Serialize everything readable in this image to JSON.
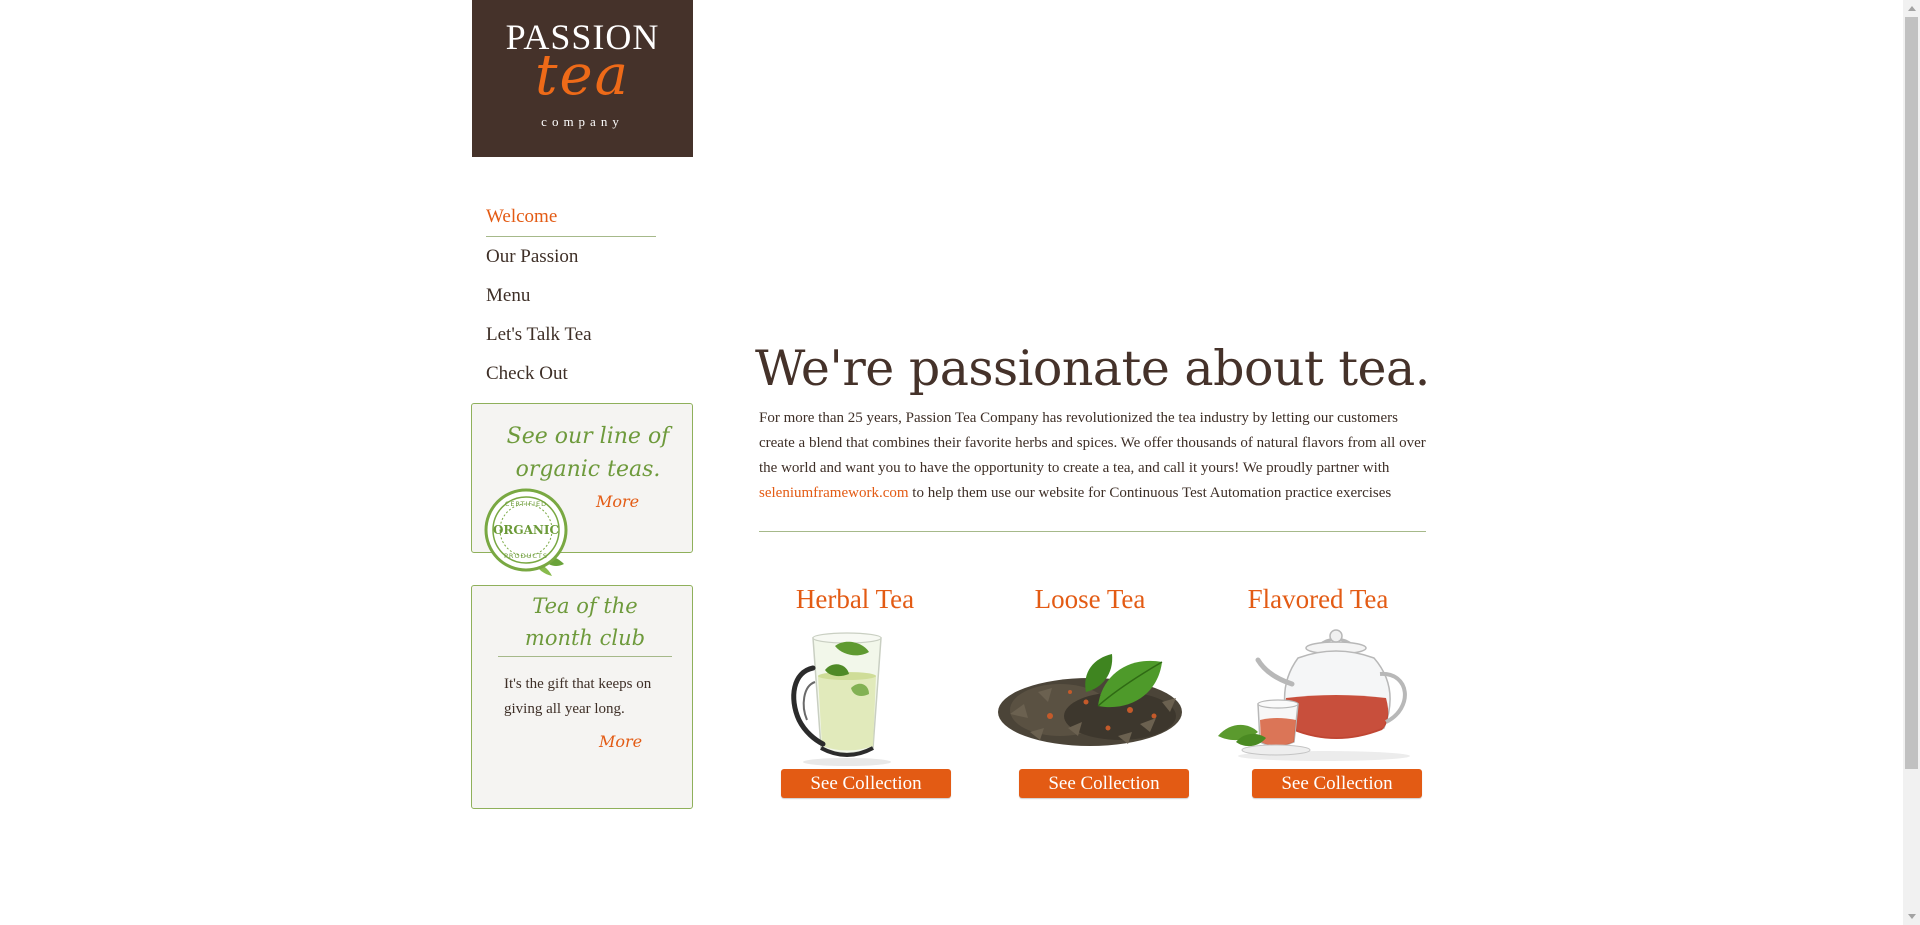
{
  "logo": {
    "passion": "PASSION",
    "tea": "tea",
    "company": "company"
  },
  "nav": {
    "items": [
      {
        "label": "Welcome"
      },
      {
        "label": "Our Passion"
      },
      {
        "label": "Menu"
      },
      {
        "label": "Let's Talk Tea"
      },
      {
        "label": "Check Out"
      }
    ]
  },
  "organic_box": {
    "line1": "See our line of",
    "line2": "organic teas.",
    "more": "More",
    "seal": {
      "top": "CERTIFIED",
      "word": "ORGANIC",
      "bottom": "PRODUCTS"
    }
  },
  "month_box": {
    "title_line1": "Tea of the",
    "title_line2": "month club",
    "description": "It's the gift that keeps on giving all year long.",
    "more": "More"
  },
  "main": {
    "headline": "We're passionate about tea.",
    "intro_before": "For more than 25 years, Passion Tea Company has revolutionized the tea industry by letting our customers create a blend that combines their favorite herbs and spices. We offer thousands of natural flavors from all over the world and want you to have the opportunity to create a tea, and call it yours! We proudly partner with ",
    "intro_link": "seleniumframework.com",
    "intro_after": " to help them use our website for Continuous Test Automation practice exercises"
  },
  "products": [
    {
      "title": "Herbal Tea",
      "button": "See Collection",
      "image": "glass-tea-cup-image"
    },
    {
      "title": "Loose Tea",
      "button": "See Collection",
      "image": "loose-leaf-tea-image"
    },
    {
      "title": "Flavored Tea",
      "button": "See Collection",
      "image": "glass-teapot-image"
    }
  ],
  "colors": {
    "accent": "#e35b14",
    "brown": "#45322a",
    "green": "#6e9a3c",
    "border_green": "#8fb05b"
  }
}
